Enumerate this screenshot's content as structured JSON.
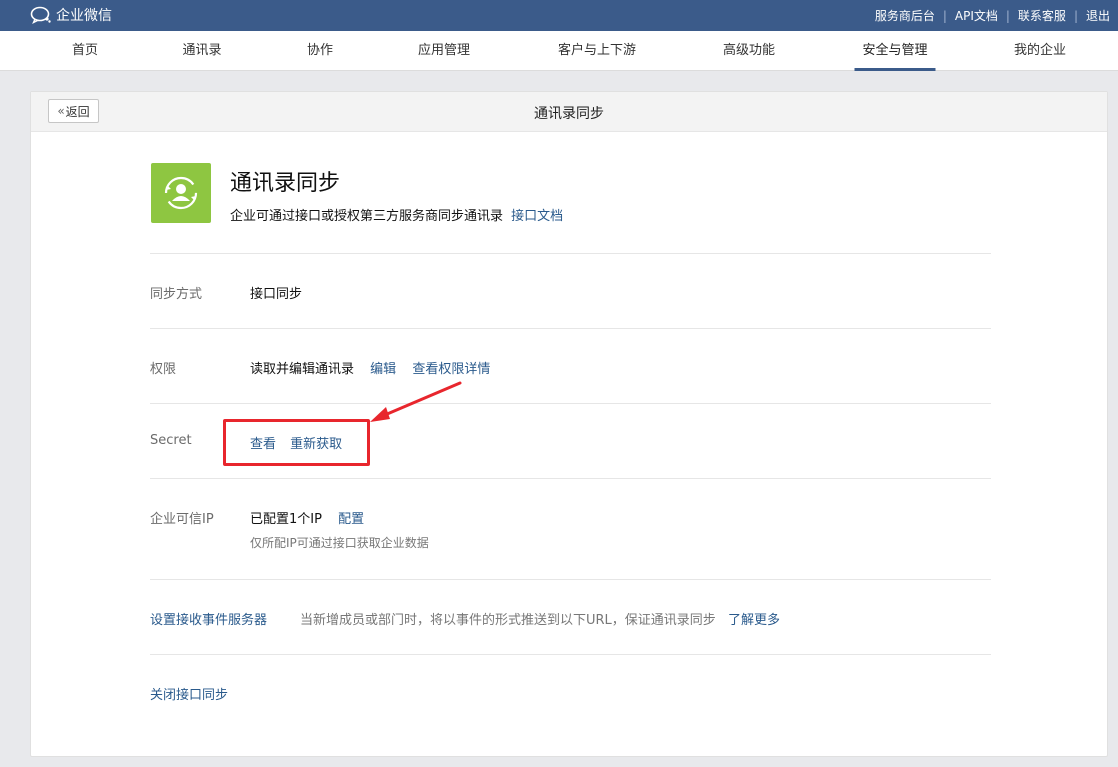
{
  "topbar": {
    "brand": "企业微信",
    "links": [
      "服务商后台",
      "API文档",
      "联系客服",
      "退出"
    ]
  },
  "nav": {
    "items": [
      "首页",
      "通讯录",
      "协作",
      "应用管理",
      "客户与上下游",
      "高级功能",
      "安全与管理",
      "我的企业"
    ],
    "active": "安全与管理"
  },
  "page": {
    "back_label": "返回",
    "title": "通讯录同步"
  },
  "app": {
    "name": "通讯录同步",
    "description": "企业可通过接口或授权第三方服务商同步通讯录",
    "doc_link": "接口文档",
    "icon": "contacts-sync-icon",
    "icon_color": "#8ec641"
  },
  "settings": {
    "sync_mode": {
      "label": "同步方式",
      "value": "接口同步"
    },
    "permission": {
      "label": "权限",
      "value": "读取并编辑通讯录",
      "edit_link": "编辑",
      "detail_link": "查看权限详情"
    },
    "secret": {
      "label": "Secret",
      "view_link": "查看",
      "refresh_link": "重新获取"
    },
    "trusted_ip": {
      "label": "企业可信IP",
      "value": "已配置1个IP",
      "config_link": "配置",
      "note": "仅所配IP可通过接口获取企业数据"
    },
    "event_server": {
      "label": "设置接收事件服务器",
      "hint": "当新增成员或部门时，将以事件的形式推送到以下URL，保证通讯录同步",
      "more_link": "了解更多"
    },
    "close_sync": {
      "label": "关闭接口同步"
    }
  },
  "annotation": {
    "highlight_color": "#e8262d"
  }
}
